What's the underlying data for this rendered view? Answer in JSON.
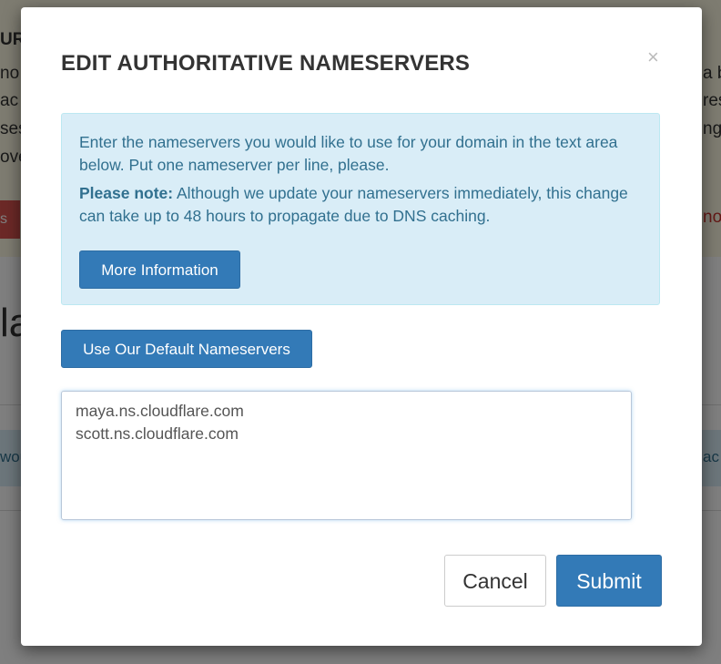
{
  "background": {
    "warning_fragments": {
      "title": "UR",
      "line1": "no",
      "line2": "ac",
      "line3": "ses",
      "line4": "ove",
      "right1": "a b",
      "right2": "res",
      "right3": "ng",
      "red_button": "s",
      "right_link": "now"
    },
    "heading_fragment": "la",
    "info_left": "wou",
    "info_right": "ac"
  },
  "modal": {
    "title": "EDIT AUTHORITATIVE NAMESERVERS",
    "close_symbol": "×",
    "info": {
      "paragraph1": "Enter the nameservers you would like to use for your domain in the text area below. Put one nameserver per line, please.",
      "note_label": "Please note:",
      "note_text": " Although we update your nameservers immediately, this change can take up to 48 hours to propagate due to DNS caching.",
      "more_info_button": "More Information"
    },
    "default_ns_button": "Use Our Default Nameservers",
    "nameservers": [
      "maya.ns.cloudflare.com",
      "scott.ns.cloudflare.com"
    ],
    "cancel_button": "Cancel",
    "submit_button": "Submit"
  }
}
